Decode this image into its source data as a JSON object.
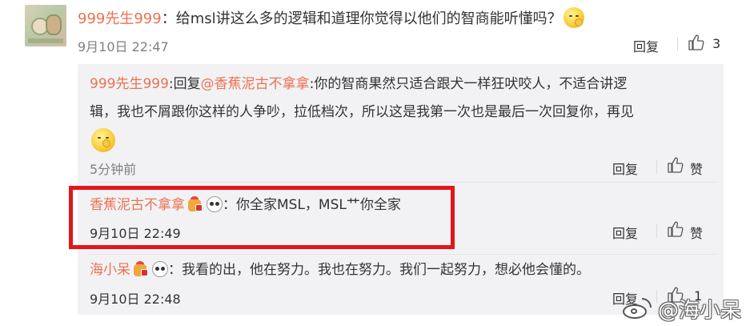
{
  "top_comment": {
    "username": "999先生999",
    "text": "：给msl讲这么多的逻辑和道理你觉得以他们的智商能听懂吗？",
    "emoji": "shush-face-emoji",
    "time": "9月10日 22:47",
    "reply_label": "回复",
    "like_count": "3"
  },
  "replies": [
    {
      "username": "999先生999",
      "text_prefix": ":回复",
      "mention": "@香蕉泥古不拿拿",
      "text_line1": ":你的智商果然只适合跟犬一样狂吠咬人，不适合讲逻",
      "text_line2": "辑，我也不屑跟你这样的人争吵，拉低档次，所以这是我第一次也是最后一次回复你，再见",
      "emoji": "shush-face-emoji",
      "time": "5分钟前",
      "reply_label": "回复",
      "like_label": "赞"
    },
    {
      "username": "香蕉泥古不拿拿",
      "badges": [
        "vip-crown-badge",
        "panda-badge"
      ],
      "text": "：你全家MSL，MSL艹你全家",
      "time": "9月10日 22:49",
      "reply_label": "回复",
      "like_label": "赞"
    },
    {
      "username": "海小呆",
      "badges": [
        "vip-crown-badge",
        "panda-badge"
      ],
      "text": "：我看的出，他在努力。我也在努力。我们一起努力，想必他会懂的。",
      "time": "9月10日 22:48",
      "reply_label": "回复",
      "like_count": "1"
    }
  ],
  "watermark": {
    "logo": "weibo-logo",
    "text": "@海小呆"
  },
  "colors": {
    "username": "#eb7350",
    "highlight_border": "#e3161b",
    "reply_bg": "#f2f2f5",
    "meta": "#808080"
  }
}
